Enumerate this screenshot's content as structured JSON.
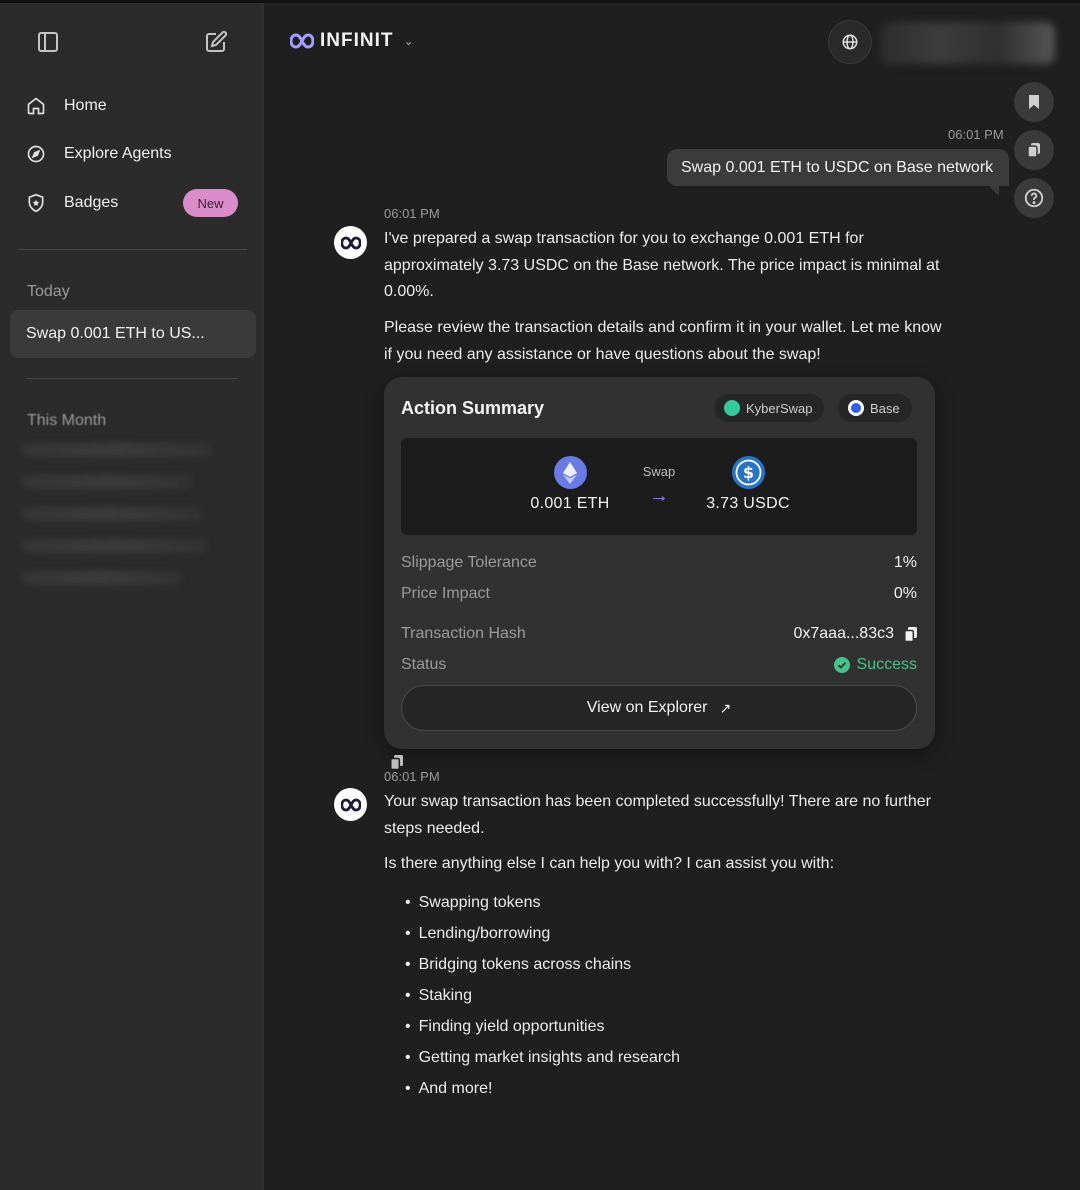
{
  "header": {
    "brand": "INFINIT"
  },
  "sidebar": {
    "nav": [
      {
        "label": "Home",
        "icon": "home-icon"
      },
      {
        "label": "Explore Agents",
        "icon": "compass-icon"
      },
      {
        "label": "Badges",
        "icon": "shield-icon",
        "badge": "New"
      }
    ],
    "sections": {
      "today": "Today",
      "month": "This Month"
    },
    "history": [
      {
        "label": "Swap 0.001 ETH to US..."
      }
    ]
  },
  "chat": {
    "user_message": {
      "time": "06:01 PM",
      "text": "Swap 0.001 ETH to USDC on Base network"
    },
    "assistant_1": {
      "time": "06:01 PM",
      "paragraph_1": "I've prepared a swap transaction for you to exchange 0.001 ETH for approximately 3.73 USDC on the Base network. The price impact is minimal at 0.00%.",
      "paragraph_2": "Please review the transaction details and confirm it in your wallet. Let me know if you need any assistance or have questions about the swap!"
    },
    "action_summary": {
      "title": "Action Summary",
      "chips": [
        {
          "label": "KyberSwap",
          "color": "#31cb9e"
        },
        {
          "label": "Base",
          "color": "#2f5df5"
        }
      ],
      "from": {
        "amount": "0.001 ETH",
        "icon": "ethereum-icon"
      },
      "swap_label": "Swap",
      "to": {
        "amount": "3.73 USDC",
        "icon": "usdc-icon"
      },
      "rows": [
        {
          "key": "Slippage Tolerance",
          "value": "1%"
        },
        {
          "key": "Price Impact",
          "value": "0%"
        },
        {
          "key": "Transaction Hash",
          "value": "0x7aaa...83c3"
        },
        {
          "key": "Status",
          "value": "Success"
        }
      ],
      "explorer_button": "View on Explorer"
    },
    "assistant_2": {
      "time": "06:01 PM",
      "paragraph_1": "Your swap transaction has been completed successfully! There are no further steps needed.",
      "paragraph_2": "Is there anything else I can help you with? I can assist you with:",
      "capabilities": [
        "Swapping tokens",
        "Lending/borrowing",
        "Bridging tokens across chains",
        "Staking",
        "Finding yield opportunities",
        "Getting market insights and research",
        "And more!"
      ]
    }
  },
  "colors": {
    "accent_purple": "#8f7ff0",
    "badge_pink": "#d98cc9",
    "success_green": "#47c28a"
  }
}
